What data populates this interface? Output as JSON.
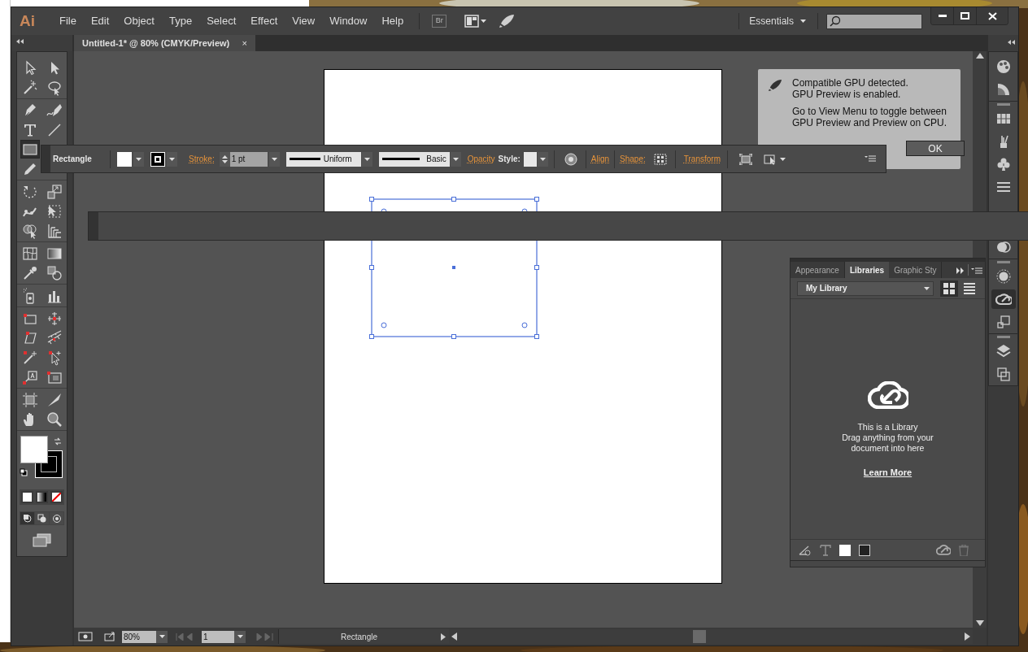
{
  "app": {
    "logo": "Ai",
    "menu": [
      "File",
      "Edit",
      "Object",
      "Type",
      "Select",
      "Effect",
      "View",
      "Window",
      "Help"
    ],
    "bridge": "Br",
    "workspace": "Essentials"
  },
  "document_tab": {
    "title": "Untitled-1* @ 80% (CMYK/Preview)",
    "close": "×"
  },
  "toolbar": {
    "groups": [
      {
        "rows": [
          [
            {
              "kind": "selection",
              "selected": false
            },
            {
              "kind": "direct-selection",
              "selected": false
            }
          ],
          [
            {
              "kind": "magic-wand",
              "selected": false
            },
            {
              "kind": "lasso",
              "selected": false
            }
          ]
        ]
      },
      {
        "rows": [
          [
            {
              "kind": "pen",
              "selected": false
            },
            {
              "kind": "curvature-pen",
              "selected": false
            }
          ],
          [
            {
              "kind": "type",
              "selected": false
            },
            {
              "kind": "line",
              "selected": false
            }
          ],
          [
            {
              "kind": "rectangle",
              "selected": true
            }
          ],
          [
            {
              "kind": "pencil",
              "selected": false
            }
          ]
        ]
      },
      {
        "rows": [
          [
            {
              "kind": "rotate",
              "selected": false
            },
            {
              "kind": "scale",
              "selected": false
            }
          ],
          [
            {
              "kind": "puppet-warp",
              "selected": false
            },
            {
              "kind": "free-transform",
              "selected": false
            }
          ],
          [
            {
              "kind": "shape-builder",
              "selected": false
            },
            {
              "kind": "perspective-grid",
              "selected": false
            }
          ]
        ]
      },
      {
        "rows": [
          [
            {
              "kind": "mesh",
              "selected": false
            },
            {
              "kind": "gradient",
              "selected": false
            }
          ],
          [
            {
              "kind": "eyedropper",
              "selected": false
            },
            {
              "kind": "blend",
              "selected": false
            }
          ]
        ]
      },
      {
        "rows": [
          [
            {
              "kind": "symbol-sprayer",
              "selected": false
            },
            {
              "kind": "column-graph",
              "selected": false
            }
          ]
        ]
      },
      {
        "rows": [
          [
            {
              "kind": "corner-frame",
              "selected": false
            },
            {
              "kind": "crosshair",
              "selected": false
            }
          ],
          [
            {
              "kind": "parallelogram",
              "selected": false
            },
            {
              "kind": "hatched-bar",
              "selected": false
            }
          ],
          [
            {
              "kind": "wand-plus",
              "selected": false
            },
            {
              "kind": "arrow-plus",
              "selected": false
            }
          ],
          [
            {
              "kind": "text-tag",
              "selected": false
            },
            {
              "kind": "frame-tag",
              "selected": false
            }
          ]
        ]
      },
      {
        "rows": [
          [
            {
              "kind": "artboard",
              "selected": false
            },
            {
              "kind": "knife",
              "selected": false
            }
          ],
          [
            {
              "kind": "hand",
              "selected": false
            },
            {
              "kind": "zoom",
              "selected": false
            }
          ]
        ]
      }
    ]
  },
  "control_bar": {
    "tool_name": "Rectangle",
    "stroke_label": "Stroke:",
    "stroke_weight": "1 pt",
    "width_profile": "Uniform",
    "brush": "Basic",
    "opacity_label": "Opacity",
    "style_label": "Style:",
    "align_label": "Align",
    "shape_label": "Shape:",
    "transform_label": "Transform"
  },
  "gpu_notice": {
    "title": "Compatible GPU detected.\nGPU Preview is enabled.",
    "message": "Go to View Menu to toggle between GPU Preview and Preview on CPU.",
    "button": "OK"
  },
  "libraries_panel": {
    "tabs": [
      {
        "label": "Appearance",
        "selected": false
      },
      {
        "label": "Libraries",
        "selected": true
      },
      {
        "label": "Graphic Sty",
        "selected": false
      }
    ],
    "library": "My Library",
    "views": [
      {
        "kind": "grid",
        "selected": true
      },
      {
        "kind": "list",
        "selected": false
      }
    ],
    "empty_text": "This is a Library\nDrag anything from your\ndocument into here",
    "link": "Learn More"
  },
  "dock": {
    "icons": [
      {
        "kind": "color",
        "selected": false
      },
      {
        "kind": "color-guide",
        "selected": false
      },
      {
        "kind": "grip"
      },
      {
        "kind": "swatches",
        "selected": false
      },
      {
        "kind": "brushes",
        "selected": false
      },
      {
        "kind": "symbols",
        "selected": false
      },
      {
        "kind": "stroke",
        "selected": false
      },
      {
        "kind": "spacer"
      },
      {
        "kind": "transparency",
        "selected": false
      },
      {
        "kind": "grip"
      },
      {
        "kind": "appearance",
        "selected": false
      },
      {
        "kind": "libraries",
        "selected": true
      },
      {
        "kind": "transform",
        "selected": false
      },
      {
        "kind": "grip"
      },
      {
        "kind": "layers",
        "selected": false
      },
      {
        "kind": "artboards",
        "selected": false
      }
    ]
  },
  "status_bar": {
    "zoom": "80%",
    "artboard": "1",
    "current_tool": "Rectangle"
  }
}
